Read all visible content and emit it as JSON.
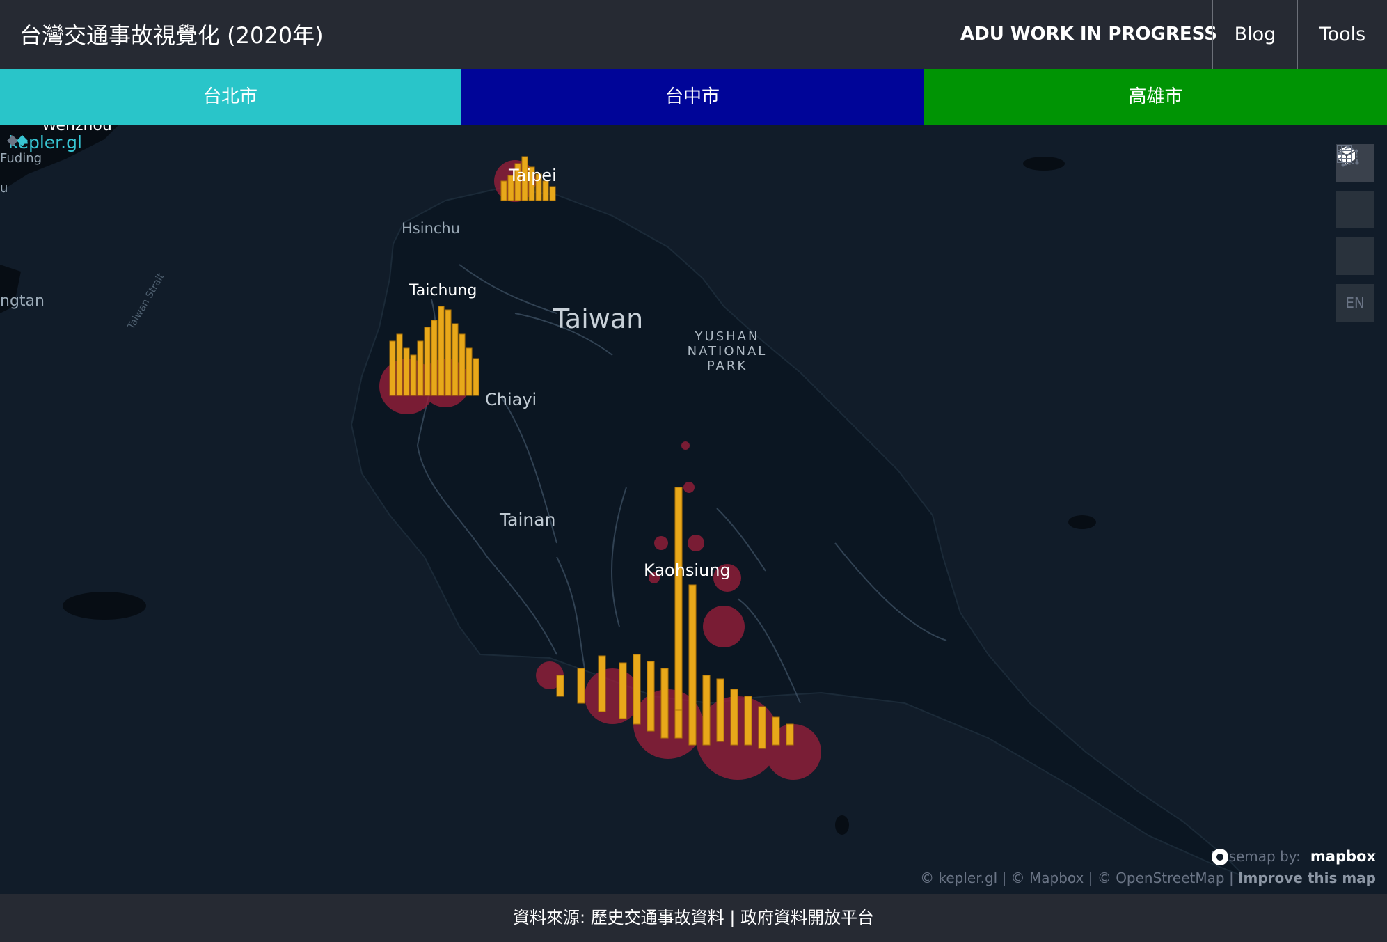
{
  "header": {
    "title": "台灣交通事故視覺化 (2020年)",
    "brand": "ADU WORK IN PROGRESS",
    "nav": [
      {
        "label": "Blog"
      },
      {
        "label": "Tools"
      }
    ]
  },
  "city_tabs": [
    {
      "label": "台北市",
      "color": "#29c5c9"
    },
    {
      "label": "台中市",
      "color": "#000598"
    },
    {
      "label": "高雄市",
      "color": "#009404"
    }
  ],
  "map": {
    "logo_text": "kepler.gl",
    "place_labels": {
      "wenzhou": "Wenzhou",
      "fuding": "Fuding",
      "u": "u",
      "pingtan": "ngtan",
      "taiwan_strait": "Taiwan Strait",
      "taipei": "Taipei",
      "hsinchu": "Hsinchu",
      "taichung": "Taichung",
      "taiwan": "Taiwan",
      "yushan": "YUSHAN NATIONAL PARK",
      "chiayi": "Chiayi",
      "tainan": "Tainan",
      "kaohsiung": "Kaohsiung"
    },
    "controls": [
      {
        "name": "3d-map-icon"
      },
      {
        "name": "data-table-icon"
      },
      {
        "name": "draw-polygon-icon"
      },
      {
        "name": "language-toggle",
        "label": "EN"
      }
    ],
    "attribution": {
      "basemap_by": "Basemap by:",
      "mapbox_logo": "mapbox",
      "credits": "© kepler.gl | © Mapbox | © OpenStreetMap | ",
      "improve": "Improve this map"
    }
  },
  "footer": {
    "prefix": "資料來源: ",
    "source": "歷史交通事故資料",
    "separator": " | ",
    "platform": "政府資料開放平台"
  }
}
